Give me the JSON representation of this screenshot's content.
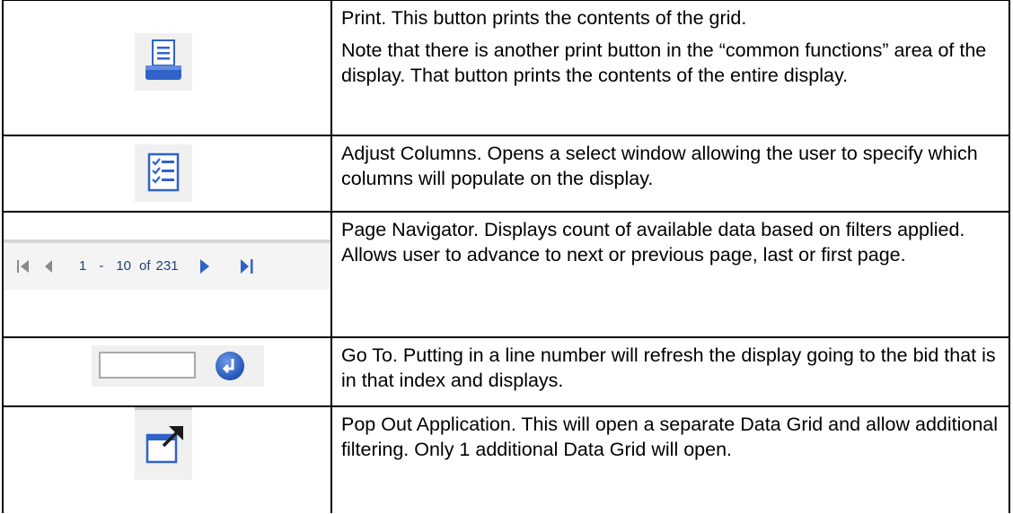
{
  "rows": [
    {
      "icon": "print-icon",
      "paragraphs": [
        "Print.  This button prints the contents of the grid.",
        "Note that there is another print button in the “common functions” area of the display.  That button prints the contents of the entire display."
      ]
    },
    {
      "icon": "adjust-columns-icon",
      "paragraphs": [
        "Adjust Columns. Opens a select window allowing the user to specify which columns will populate on the display."
      ]
    },
    {
      "icon": "page-navigator",
      "paragraphs": [
        "Page Navigator. Displays count of available data based on filters applied. Allows user to advance to next or previous page, last or first page."
      ],
      "navigator": {
        "start": "1",
        "dash": "-",
        "end": "10",
        "of_label": "of",
        "total": "231"
      }
    },
    {
      "icon": "go-to-icon",
      "paragraphs": [
        "Go To.   Putting in a line number will refresh the display going to the bid that is in that index and displays."
      ]
    },
    {
      "icon": "pop-out-icon",
      "paragraphs": [
        "Pop Out Application. This will open a separate Data Grid and allow additional filtering. Only 1 additional Data Grid will open."
      ]
    }
  ],
  "colors": {
    "icon_blue": "#2f63c9",
    "border": "#000000",
    "icon_bg": "#f0f0f0"
  }
}
